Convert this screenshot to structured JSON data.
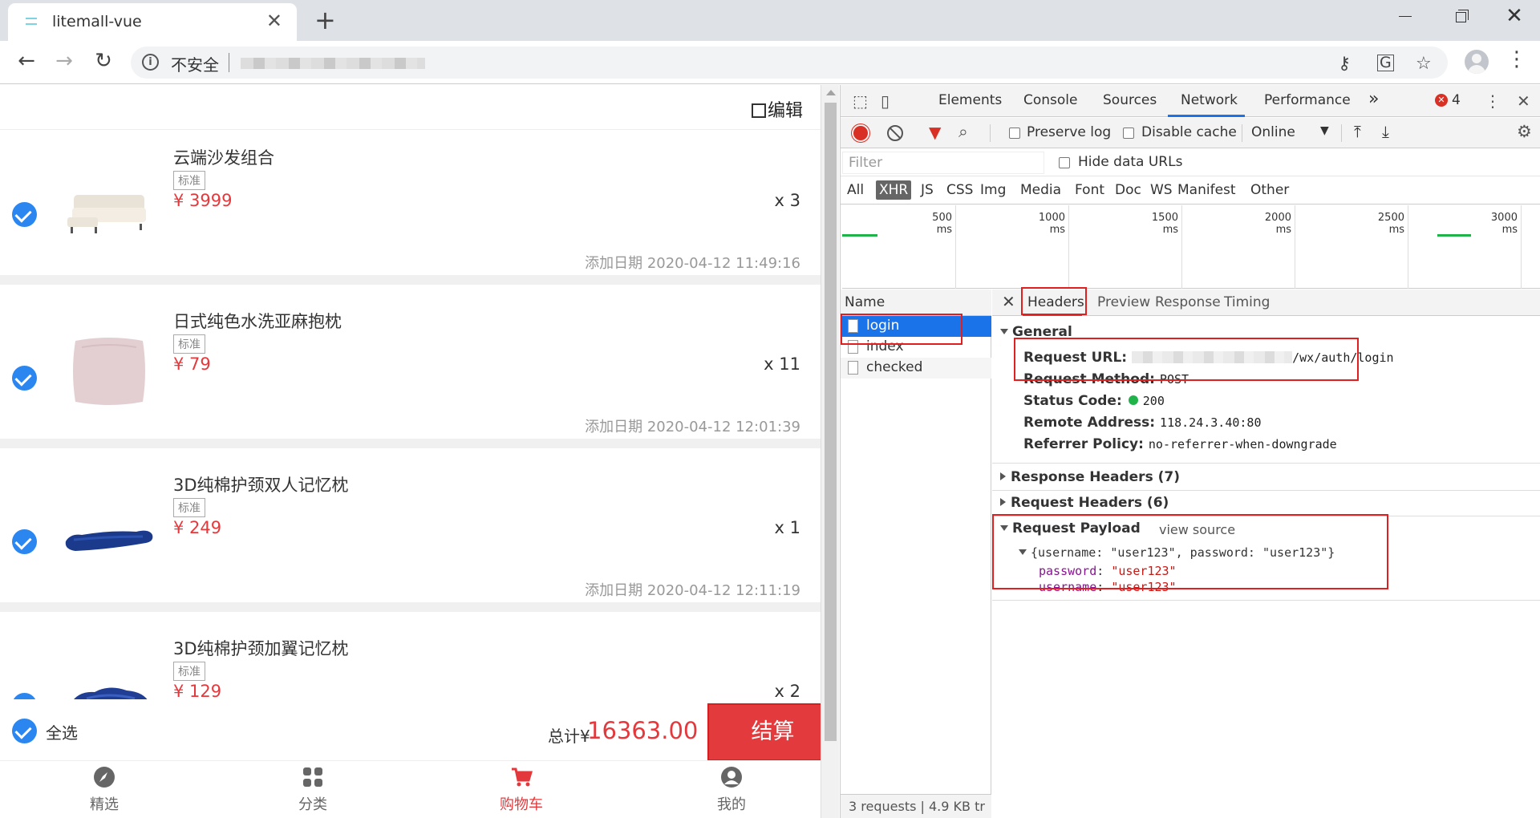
{
  "browser": {
    "tab_title": "litemall-vue",
    "tab_close": "✕",
    "new_tab": "+",
    "insecure_label": "不安全",
    "info_glyph": "i"
  },
  "shop": {
    "edit_label": "编辑",
    "items": [
      {
        "name": "云端沙发组合",
        "spec": "标准",
        "price": "¥ 3999",
        "qty": "x 3",
        "date": "添加日期 2020-04-12 11:49:16"
      },
      {
        "name": "日式纯色水洗亚麻抱枕",
        "spec": "标准",
        "price": "¥ 79",
        "qty": "x 11",
        "date": "添加日期 2020-04-12 12:01:39"
      },
      {
        "name": "3D纯棉护颈双人记忆枕",
        "spec": "标准",
        "price": "¥ 249",
        "qty": "x 1",
        "date": "添加日期 2020-04-12 12:11:19"
      },
      {
        "name": "3D纯棉护颈加翼记忆枕",
        "spec": "标准",
        "price": "¥ 129",
        "qty": "x 2",
        "date": ""
      }
    ],
    "select_all": "全选",
    "total_label": "总计¥",
    "total_value": "16363.00",
    "checkout": "结算",
    "tabbar": [
      {
        "label": "精选",
        "icon": "compass-icon"
      },
      {
        "label": "分类",
        "icon": "grid-icon"
      },
      {
        "label": "购物车",
        "icon": "cart-icon"
      },
      {
        "label": "我的",
        "icon": "user-icon"
      }
    ]
  },
  "devtools": {
    "tabs": [
      "Elements",
      "Console",
      "Sources",
      "Network",
      "Performance"
    ],
    "active_tab": "Network",
    "more": "»",
    "error_count": "4",
    "preserve_log": "Preserve log",
    "disable_cache": "Disable cache",
    "throttle": "Online",
    "filter_placeholder": "Filter",
    "hide_data_urls": "Hide data URLs",
    "types": [
      "All",
      "XHR",
      "JS",
      "CSS",
      "Img",
      "Media",
      "Font",
      "Doc",
      "WS",
      "Manifest",
      "Other"
    ],
    "selected_type": "XHR",
    "timeline": [
      "500 ms",
      "1000 ms",
      "1500 ms",
      "2000 ms",
      "2500 ms",
      "3000 ms"
    ],
    "name_header": "Name",
    "requests": [
      "login",
      "index",
      "checked"
    ],
    "footer": "3 requests | 4.9 KB tr",
    "detail_tabs": [
      "Headers",
      "Preview",
      "Response",
      "Timing"
    ],
    "general": {
      "title": "General",
      "request_url_key": "Request URL:",
      "request_url_value": "/wx/auth/login",
      "request_method_key": "Request Method:",
      "request_method_value": "POST",
      "status_key": "Status Code:",
      "status_value": "200",
      "remote_key": "Remote Address:",
      "remote_value": "118.24.3.40:80",
      "referrer_key": "Referrer Policy:",
      "referrer_value": "no-referrer-when-downgrade"
    },
    "response_headers": "Response Headers (7)",
    "request_headers": "Request Headers (6)",
    "payload": {
      "title": "Request Payload",
      "view_source": "view source",
      "summary": "{username: \"user123\", password: \"user123\"}",
      "password_key": "password",
      "password_value": "\"user123\"",
      "username_key": "username",
      "username_value": "\"user123\""
    }
  }
}
